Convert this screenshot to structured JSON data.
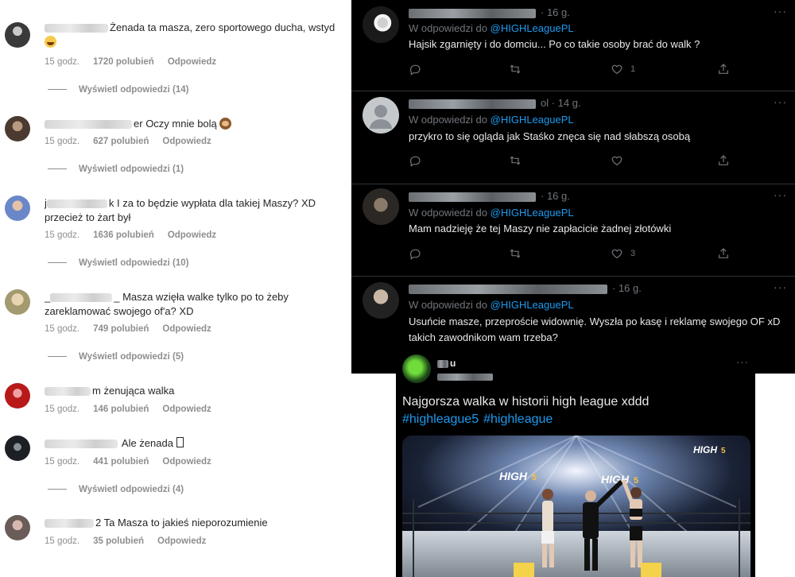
{
  "instagram": {
    "comments": [
      {
        "user_suffix": "",
        "text": "Żenada ta masza, zero sportowego ducha, wstyd",
        "emoji": "laughing-emoji",
        "time": "15 godz.",
        "likes": "1720 polubień",
        "reply": "Odpowiedz",
        "view_replies": "Wyświetl odpowiedzi (14)"
      },
      {
        "user_suffix": "er",
        "text": "Oczy mnie bolą",
        "emoji": "see-no-evil-monkey-emoji",
        "time": "15 godz.",
        "likes": "627 polubień",
        "reply": "Odpowiedz",
        "view_replies": "Wyświetl odpowiedzi (1)"
      },
      {
        "user_prefix": "j",
        "user_suffix": "k",
        "text": "I za to będzie wypłata dla takiej Maszy? XD przecież to żart był",
        "time": "15 godz.",
        "likes": "1636 polubień",
        "reply": "Odpowiedz",
        "view_replies": "Wyświetl odpowiedzi (10)"
      },
      {
        "user_prefix": "_",
        "user_suffix": "_",
        "text": "Masza wzięła walke tylko po to żeby zareklamować swojego of'a? XD",
        "time": "15 godz.",
        "likes": "749 polubień",
        "reply": "Odpowiedz",
        "view_replies": "Wyświetl odpowiedzi (5)"
      },
      {
        "user_suffix": "m",
        "text": "żenująca walka",
        "time": "15 godz.",
        "likes": "146 polubień",
        "reply": "Odpowiedz"
      },
      {
        "user_suffix": "",
        "text": "Ale żenada",
        "box": true,
        "time": "15 godz.",
        "likes": "441 polubień",
        "reply": "Odpowiedz",
        "view_replies": "Wyświetl odpowiedzi (4)"
      },
      {
        "user_suffix": "2",
        "text": "Ta Masza to jakieś nieporozumienie",
        "time": "15 godz.",
        "likes": "35 polubień",
        "reply": "Odpowiedz"
      }
    ]
  },
  "twitter": {
    "reply_prefix": "W odpowiedzi do",
    "mention": "@HIGHLeaguePL",
    "more": "···",
    "tweets": [
      {
        "time": "· 16 g.",
        "text": "Hajsik zgarnięty i do domciu... Po co takie osoby brać do walk ?",
        "likes": "1"
      },
      {
        "time": "ol · 14 g.",
        "text": "przykro to się ogląda jak Staśko znęca się nad słabszą osobą",
        "likes": ""
      },
      {
        "time": "· 16 g.",
        "text": "Mam nadzieję że tej Maszy nie zapłacicie żadnej złotówki",
        "likes": "3"
      },
      {
        "time": "· 16 g.",
        "text": "Usuńcie masze, przeproście widownię. Wyszła po kasę i reklamę swojego OF xD takich zawodnikom wam trzeba?",
        "likes": ""
      }
    ],
    "quoted": {
      "name_suffix": "u",
      "more": "···",
      "text": "Najgorsza walka w historii high league xddd",
      "hashtags": [
        "#highleague5",
        "#highleague"
      ],
      "media_logo": "HIGH",
      "media_logo_num": "5"
    }
  },
  "colors": {
    "twitter_bg": "#000000",
    "twitter_text": "#e7e9ea",
    "twitter_muted": "#71767b",
    "twitter_link": "#1d9bf0",
    "ig_text": "#262626",
    "ig_muted": "#8e8e8e"
  }
}
